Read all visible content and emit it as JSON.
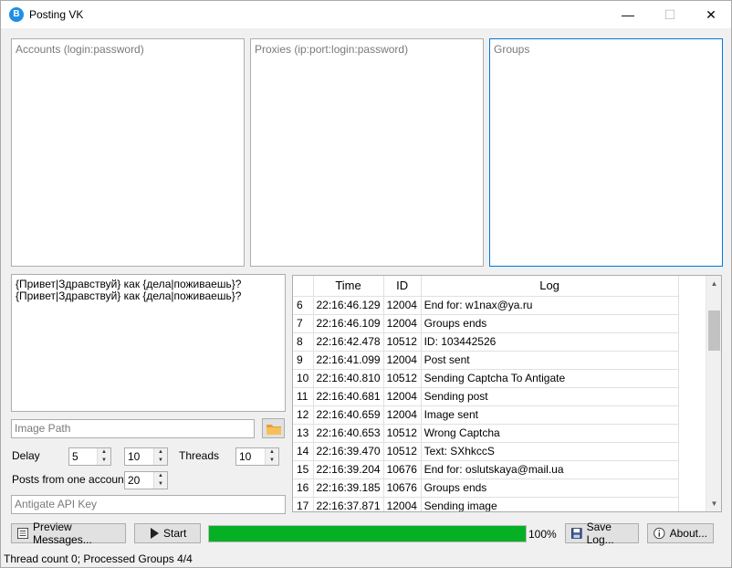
{
  "window": {
    "title": "Posting VK",
    "minimize_glyph": "—",
    "maximize_glyph": "☐",
    "close_glyph": "✕"
  },
  "accounts": {
    "placeholder": "Accounts (login:password)"
  },
  "proxies": {
    "placeholder": "Proxies (ip:port:login:password)"
  },
  "groups": {
    "placeholder": "Groups"
  },
  "messages": {
    "text": "{Привет|Здравствуй} как {дела|поживаешь}?\n{Привет|Здравствуй} как {дела|поживаешь}?"
  },
  "image_path": {
    "placeholder": "Image Path"
  },
  "settings": {
    "delay_label": "Delay",
    "delay_min": "5",
    "delay_max": "10",
    "threads_label": "Threads",
    "threads": "10",
    "posts_label": "Posts from one account",
    "posts": "20"
  },
  "antigate": {
    "placeholder": "Antigate API Key"
  },
  "log": {
    "headers": {
      "time": "Time",
      "id": "ID",
      "log": "Log"
    },
    "rows": [
      {
        "n": "6",
        "time": "22:16:46.129",
        "id": "12004",
        "msg": "End for: w1nax@ya.ru"
      },
      {
        "n": "7",
        "time": "22:16:46.109",
        "id": "12004",
        "msg": "Groups ends"
      },
      {
        "n": "8",
        "time": "22:16:42.478",
        "id": "10512",
        "msg": "ID: 103442526"
      },
      {
        "n": "9",
        "time": "22:16:41.099",
        "id": "12004",
        "msg": "Post sent"
      },
      {
        "n": "10",
        "time": "22:16:40.810",
        "id": "10512",
        "msg": "Sending Captcha To Antigate"
      },
      {
        "n": "11",
        "time": "22:16:40.681",
        "id": "12004",
        "msg": "Sending post"
      },
      {
        "n": "12",
        "time": "22:16:40.659",
        "id": "12004",
        "msg": "Image sent"
      },
      {
        "n": "13",
        "time": "22:16:40.653",
        "id": "10512",
        "msg": "Wrong Captcha"
      },
      {
        "n": "14",
        "time": "22:16:39.470",
        "id": "10512",
        "msg": "Text: SXhkccS"
      },
      {
        "n": "15",
        "time": "22:16:39.204",
        "id": "10676",
        "msg": "End for: oslutskaya@mail.ua"
      },
      {
        "n": "16",
        "time": "22:16:39.185",
        "id": "10676",
        "msg": "Groups ends"
      },
      {
        "n": "17",
        "time": "22:16:37.871",
        "id": "12004",
        "msg": "Sending image"
      }
    ]
  },
  "toolbar": {
    "preview_label": "Preview Messages...",
    "start_label": "Start",
    "progress_value": 100,
    "progress_text": "100%",
    "save_label": "Save Log...",
    "about_label": "About..."
  },
  "status": {
    "text": "Thread count 0; Processed Groups 4/4"
  },
  "colors": {
    "progress": "#06b025",
    "focus": "#0078d7"
  }
}
